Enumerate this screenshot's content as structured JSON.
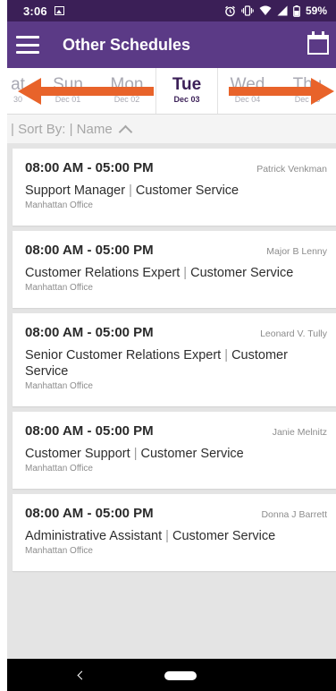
{
  "status_bar": {
    "time": "3:06",
    "battery": "59%"
  },
  "app_bar": {
    "title": "Other Schedules"
  },
  "days": [
    {
      "name": "at",
      "date": "30"
    },
    {
      "name": "Sun",
      "date": "Dec 01"
    },
    {
      "name": "Mon",
      "date": "Dec 02"
    },
    {
      "name": "Tue",
      "date": "Dec 03",
      "selected": true
    },
    {
      "name": "Wed",
      "date": "Dec 04"
    },
    {
      "name": "Thu",
      "date": "Dec 05"
    }
  ],
  "sort_bar": {
    "label": "| Sort By: | Name"
  },
  "schedules": [
    {
      "time": "08:00 AM - 05:00 PM",
      "person": "Patrick Venkman",
      "role": "Support Manager",
      "department": "Customer Service",
      "office": "Manhattan Office"
    },
    {
      "time": "08:00 AM - 05:00 PM",
      "person": "Major B Lenny",
      "role": "Customer Relations Expert",
      "department": "Customer Service",
      "office": "Manhattan Office"
    },
    {
      "time": "08:00 AM - 05:00 PM",
      "person": "Leonard V. Tully",
      "role": "Senior Customer Relations Expert",
      "department": "Customer Service",
      "office": "Manhattan Office"
    },
    {
      "time": "08:00 AM - 05:00 PM",
      "person": "Janie Melnitz",
      "role": "Customer Support",
      "department": "Customer Service",
      "office": "Manhattan Office"
    },
    {
      "time": "08:00 AM - 05:00 PM",
      "person": "Donna J Barrett",
      "role": "Administrative Assistant",
      "department": "Customer Service",
      "office": "Manhattan Office"
    }
  ],
  "colors": {
    "status_bar": "#3b1f57",
    "app_bar": "#5b3a86",
    "arrow": "#e8632a",
    "list_background": "#e4e4e4"
  }
}
